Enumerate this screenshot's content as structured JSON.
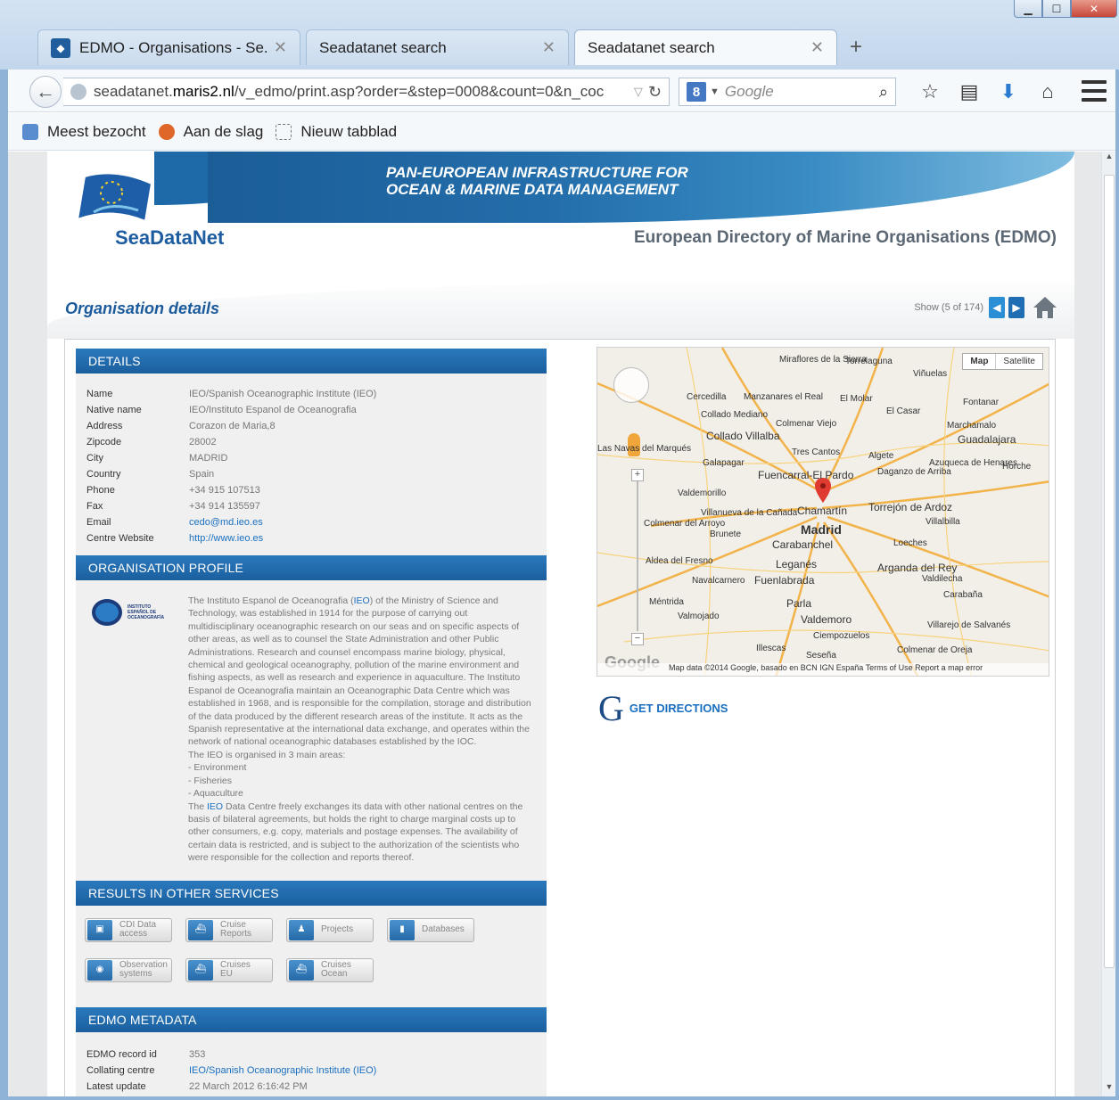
{
  "browser": {
    "tabs": [
      {
        "title": "EDMO - Organisations - Se...",
        "active": false
      },
      {
        "title": "Seadatanet search",
        "active": false
      },
      {
        "title": "Seadatanet search",
        "active": true
      }
    ],
    "url_prefix": "seadatanet.",
    "url_host": "maris2.nl",
    "url_path": "/v_edmo/print.asp?order=&step=0008&count=0&n_coc",
    "search_placeholder": "Google",
    "bookmarks": [
      "Meest bezocht",
      "Aan de slag",
      "Nieuw tabblad"
    ]
  },
  "banner": {
    "tagline": "PAN-EUROPEAN INFRASTRUCTURE FOR OCEAN & MARINE DATA MANAGEMENT",
    "logo_text": "SeaDataNet",
    "site_title": "European Directory of Marine Organisations (EDMO)"
  },
  "page": {
    "title": "Organisation details",
    "pager_text": "Show (5 of 174)"
  },
  "details": {
    "heading": "DETAILS",
    "rows": [
      {
        "label": "Name",
        "value": "IEO/Spanish Oceanographic Institute (IEO)",
        "link": false
      },
      {
        "label": "Native name",
        "value": "IEO/Instituto Espanol de Oceanografia",
        "link": false
      },
      {
        "label": "Address",
        "value": "Corazon de Maria,8",
        "link": false
      },
      {
        "label": "Zipcode",
        "value": "28002",
        "link": false
      },
      {
        "label": "City",
        "value": "MADRID",
        "link": false
      },
      {
        "label": "Country",
        "value": "Spain",
        "link": false
      },
      {
        "label": "Phone",
        "value": "+34 915 107513",
        "link": false
      },
      {
        "label": "Fax",
        "value": "+34 914 135597",
        "link": false
      },
      {
        "label": "Email",
        "value": "cedo@md.ieo.es",
        "link": true
      },
      {
        "label": "Centre Website",
        "value": "http://www.ieo.es",
        "link": true
      }
    ]
  },
  "profile": {
    "heading": "ORGANISATION PROFILE",
    "p1_a": "The Instituto Espanol de Oceanografia (",
    "p1_link": "IEO",
    "p1_b": ") of the Ministry of Science and Technology, was established in 1914 for the purpose of carrying out multidisciplinary oceanographic research on our seas and on specific aspects of other areas, as well as to counsel the State Administration and other Public Administrations. Research and counsel encompass marine biology, physical, chemical and geological oceanography, pollution of the marine environment and fishing aspects, as well as research and experience in aquaculture. The Instituto Espanol de Oceanografia maintain an Oceanographic Data Centre which was established in 1968, and is responsible for the compilation, storage and distribution of the data produced by the different research areas of the institute. It acts as the Spanish representative at the international data exchange, and operates within the network of national oceanographic databases established by the IOC.",
    "p2": "The IEO is organised in 3 main areas:",
    "areas": [
      "- Environment",
      "- Fisheries",
      "- Aquaculture"
    ],
    "p3_a": "The ",
    "p3_link": "IEO",
    "p3_b": " Data Centre freely exchanges its data with other national centres on the basis of bilateral agreements, but holds the right to charge marginal costs up to other consumers, e.g. copy, materials and postage expenses. The availability of certain data is restricted, and is subject to the authorization of the scientists who were responsible for the collection and reports thereof."
  },
  "results": {
    "heading": "RESULTS IN OTHER SERVICES",
    "buttons": [
      {
        "label1": "CDI Data",
        "label2": "access",
        "icon": "data-icon"
      },
      {
        "label1": "Cruise",
        "label2": "Reports",
        "icon": "ship-icon"
      },
      {
        "label1": "Projects",
        "label2": "",
        "icon": "person-icon"
      },
      {
        "label1": "Databases",
        "label2": "",
        "icon": "database-icon"
      },
      {
        "label1": "Observation",
        "label2": "systems",
        "icon": "observation-icon"
      },
      {
        "label1": "Cruises",
        "label2": "EU",
        "icon": "ship-icon"
      },
      {
        "label1": "Cruises",
        "label2": "Ocean",
        "icon": "ship-icon"
      }
    ]
  },
  "metadata": {
    "heading": "EDMO METADATA",
    "rows": [
      {
        "label": "EDMO record id",
        "value": "353",
        "link": false
      },
      {
        "label": "Collating centre",
        "value": "IEO/Spanish Oceanographic Institute (IEO)",
        "link": true
      },
      {
        "label": "Latest update",
        "value": "22 March 2012 6:16:42 PM",
        "link": false
      }
    ]
  },
  "map": {
    "type_map": "Map",
    "type_satellite": "Satellite",
    "labels": [
      "Miraflores de la Sierra",
      "Torrelaguna",
      "Viñuelas",
      "Cercedilla",
      "Manzanares el Real",
      "El Molar",
      "El Casar",
      "Fontanar",
      "Collado Mediano",
      "Colmenar Viejo",
      "Marchamalo",
      "Collado Villalba",
      "Guadalajara",
      "Las Navas del Marqués",
      "Tres Cantos",
      "Algete",
      "Azuqueca de Henares",
      "Horche",
      "Galapagar",
      "Fuencarral-El Pardo",
      "Daganzo de Arriba",
      "Valdemorillo",
      "Villanueva de la Cañada",
      "Chamartín",
      "Torrejón de Ardoz",
      "Colmenar del Arroyo",
      "Brunete",
      "Madrid",
      "Villalbilla",
      "Carabanchel",
      "Loeches",
      "Aldea del Fresno",
      "Leganés",
      "Arganda del Rey",
      "Valdilecha",
      "Navalcarnero",
      "Fuenlabrada",
      "Carabaña",
      "Méntrida",
      "Parla",
      "Valmojado",
      "Valdemoro",
      "Villarejo de Salvanés",
      "Ciempozuelos",
      "Illescas",
      "Colmenar de Oreja",
      "Seseña"
    ],
    "footer": "Map data ©2014 Google, basado en BCN IGN España   Terms of Use   Report a map error",
    "directions": "GET DIRECTIONS"
  }
}
